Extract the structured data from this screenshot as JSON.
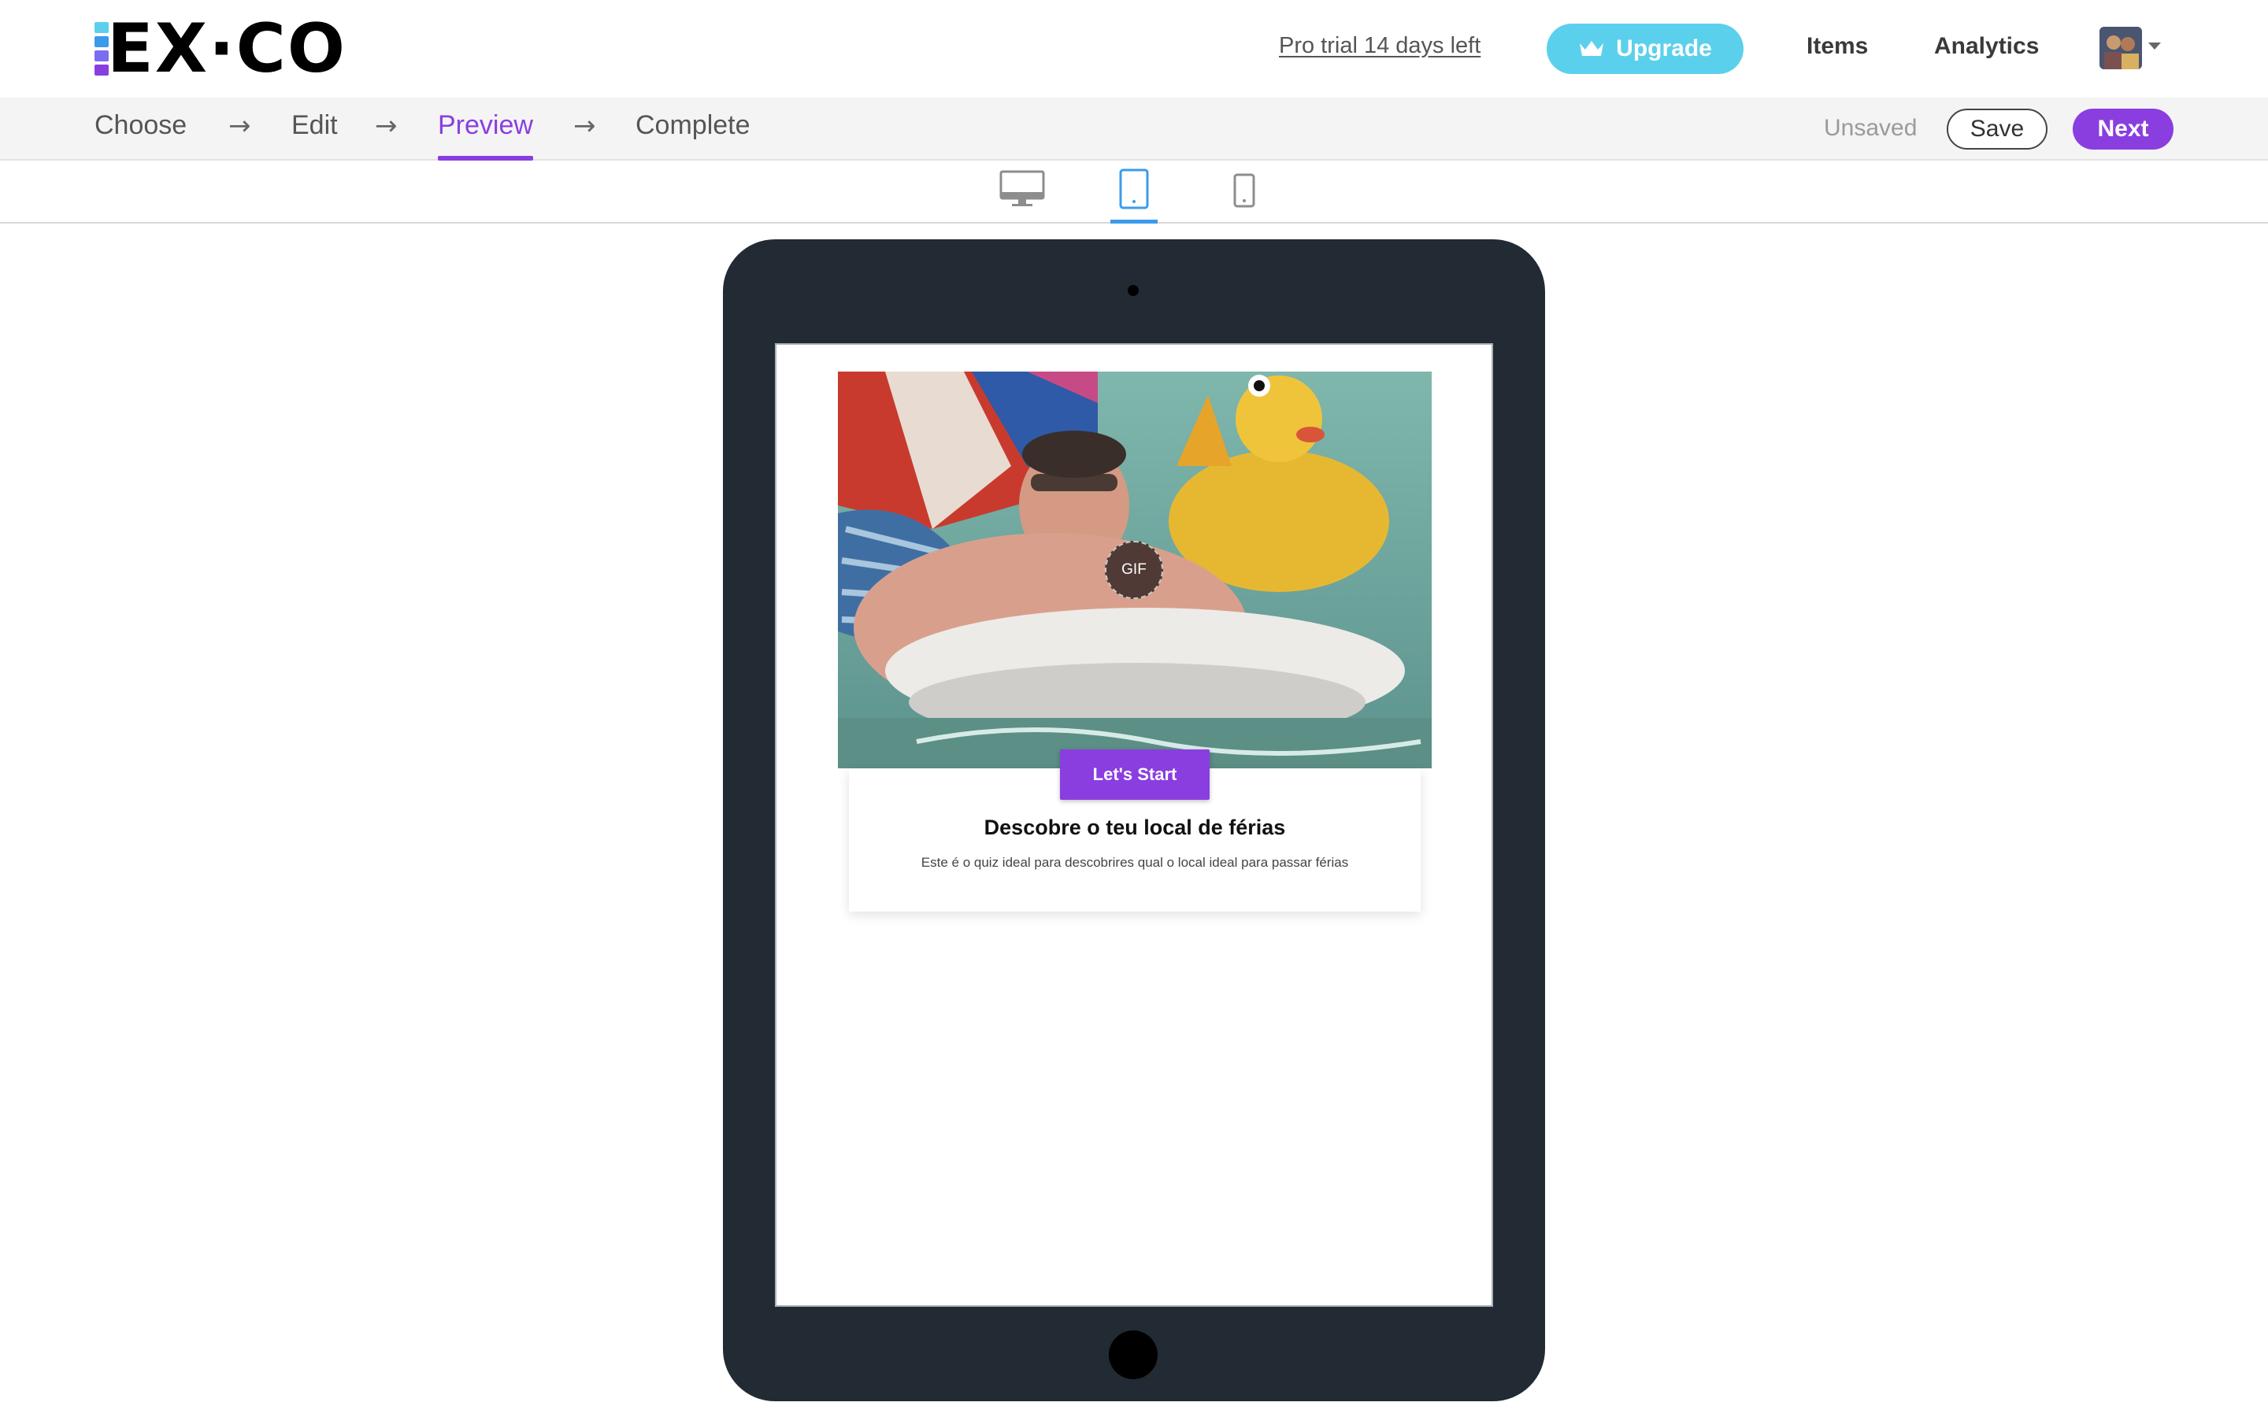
{
  "brand": {
    "logo_text": "EX·CO",
    "logo_bar_colors": [
      "#5bd0ec",
      "#3b9bea",
      "#7b6cf0",
      "#8a3ee0"
    ]
  },
  "header": {
    "trial_text": "Pro trial 14 days left",
    "upgrade_label": "Upgrade",
    "upgrade_icon": "crown-icon",
    "nav": [
      {
        "label": "Items"
      },
      {
        "label": "Analytics"
      }
    ],
    "avatar_icon": "user-avatar"
  },
  "steps": {
    "items": [
      {
        "label": "Choose",
        "active": false
      },
      {
        "label": "Edit",
        "active": false
      },
      {
        "label": "Preview",
        "active": true
      },
      {
        "label": "Complete",
        "active": false
      }
    ],
    "separator": "→",
    "status_text": "Unsaved",
    "save_label": "Save",
    "next_label": "Next"
  },
  "device_toggle": {
    "options": [
      {
        "icon": "desktop-icon",
        "selected": false
      },
      {
        "icon": "tablet-icon",
        "selected": true
      },
      {
        "icon": "mobile-icon",
        "selected": false
      }
    ]
  },
  "preview": {
    "gif_badge": "GIF",
    "start_label": "Let's Start",
    "title": "Descobre o teu local de férias",
    "description": "Este é o quiz ideal para descobrires qual o local ideal para passar férias"
  },
  "colors": {
    "accent": "#8a3ee0",
    "upgrade": "#5bd0ec",
    "device_selected": "#3b9bea",
    "tablet_body": "#222b33"
  }
}
